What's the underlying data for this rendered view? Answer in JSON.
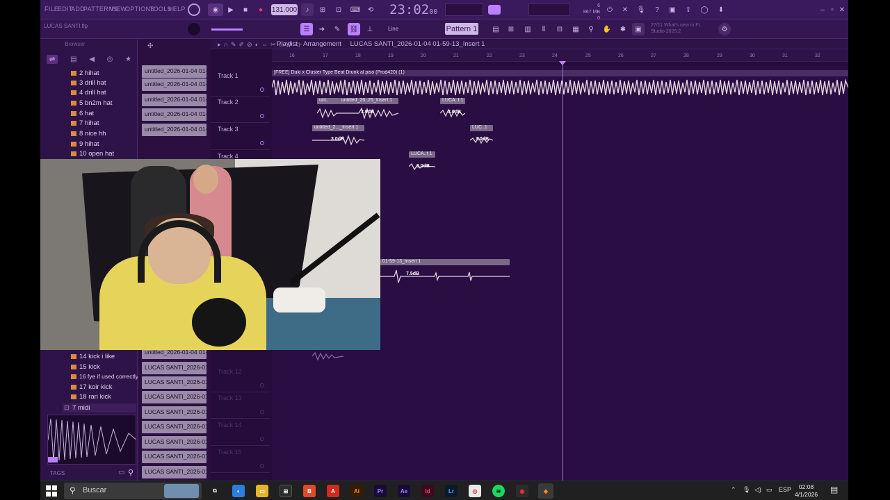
{
  "menu": [
    "FILE",
    "EDIT",
    "ADD",
    "PATTERNS",
    "VIEW",
    "OPTIONS",
    "TOOLS",
    "HELP"
  ],
  "transport": {
    "tempo": "131.000",
    "time": "23:02",
    "time_sub": "00"
  },
  "cpu": {
    "line1": "6",
    "line2": "867 MB",
    "line3": "0"
  },
  "toolbar2": {
    "filename": "LUCAS SANTI.flp",
    "snap": "Line",
    "pattern": "Pattern 1",
    "news_line1": "27/11  What's new in FL",
    "news_line2": "Studio 2025.2"
  },
  "browser": {
    "title": "Browser",
    "items": [
      "2 hihat",
      "3 drill hat",
      "4 drill hat",
      "5 bn2m hat",
      "6 hat",
      "7 hihat",
      "8 nice hh",
      "9 hihat",
      "10 open hat"
    ],
    "items_lower": [
      "14 kick i like",
      "15 kick",
      "16 fye if used correctly",
      "17 koir kick",
      "18 rari kick"
    ],
    "folder_open": "7 midi",
    "tags": "TAGS"
  },
  "cliplist": {
    "top": [
      "untitled_2026-01-04 01-",
      "untitled_2026-01-04 01-",
      "untitled_2026-01-04 01-",
      "untitled_2026-01-04 01-",
      "untitled_2026-01-04 01-"
    ],
    "bottom": [
      "untitled_2026-01-04 01-",
      "LUCAS SANTI_2026-01-04..",
      "LUCAS SANTI_2026-01-04..",
      "LUCAS SANTI_2026-01-04..",
      "LUCAS SANTI_2026-01-04..",
      "LUCAS SANTI_2026-01-04..",
      "LUCAS SANTI_2026-01-04..",
      "LUCAS SANTI_2026-01-04..",
      "LUCAS SANTI_2026-01-04.."
    ]
  },
  "playlist": {
    "title": "Playlist - Arrangement",
    "song": "LUCAS SANTI_2026-01-04 01-59-13_Insert 1",
    "ruler": [
      "16",
      "17",
      "18",
      "19",
      "20",
      "21",
      "22",
      "23",
      "24",
      "25",
      "26",
      "27",
      "28",
      "29",
      "30",
      "31",
      "32"
    ],
    "tracks": [
      "Track 1",
      "Track 2",
      "Track 3",
      "Track 4"
    ],
    "tracks_dim": [
      "Track 12",
      "Track 13",
      "Track 14",
      "Track 15"
    ],
    "clips": {
      "t1": "[FREE] Duki x Cluster Type Beat Drunk al piso (Prod420) (1)",
      "t2a": "unt..",
      "t2b": "untitled_20..25_Insert 1",
      "t2c": "LUCA..t 1",
      "t3a": "untitled_2..._Insert 1",
      "t3b": "LUC..1",
      "t4": "LUCA..t 1",
      "t11": "01-59-13_Insert 1"
    },
    "gains": {
      "g1": "3.0dB",
      "g2": "3.0dB",
      "g3": "3.0dB",
      "g4": "3.0dB",
      "g5": "3.0dB",
      "g6": "7.5dB"
    }
  },
  "taskbar": {
    "search": "Buscar",
    "lang": "ESP",
    "time": "02:08",
    "date": "4/1/2026"
  },
  "colors": {
    "accent": "#b980ff",
    "bg": "#2a0f40",
    "clip": "#9a8aa8",
    "wave": "#e8d8e0"
  }
}
